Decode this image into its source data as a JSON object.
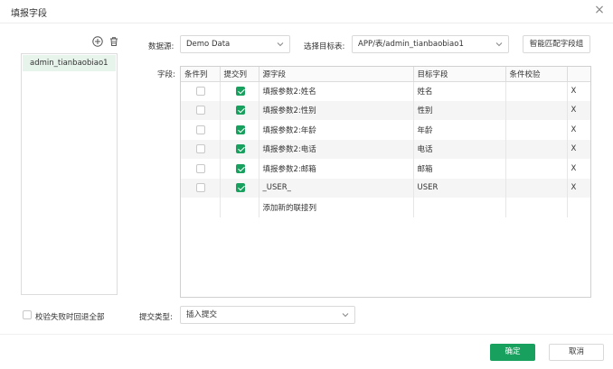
{
  "dialog": {
    "title": "填报字段"
  },
  "datasource_panel": {
    "items": [
      {
        "label": "admin_tianbaobiao1"
      }
    ]
  },
  "form": {
    "datasource_label": "数据源:",
    "datasource_value": "Demo Data",
    "target_table_label": "选择目标表:",
    "target_table_value": "APP/表/admin_tianbaobiao1",
    "smart_match_label": "智能匹配字段组",
    "fields_label": "字段:"
  },
  "grid": {
    "headers": [
      "条件列",
      "提交列",
      "源字段",
      "目标字段",
      "条件校验",
      ""
    ],
    "rows": [
      {
        "condition": false,
        "submit": true,
        "source": "填报参数2:姓名",
        "target": "姓名",
        "check": "",
        "delete": "X"
      },
      {
        "condition": false,
        "submit": true,
        "source": "填报参数2:性别",
        "target": "性别",
        "check": "",
        "delete": "X"
      },
      {
        "condition": false,
        "submit": true,
        "source": "填报参数2:年龄",
        "target": "年龄",
        "check": "",
        "delete": "X"
      },
      {
        "condition": false,
        "submit": true,
        "source": "填报参数2:电话",
        "target": "电话",
        "check": "",
        "delete": "X"
      },
      {
        "condition": false,
        "submit": true,
        "source": "填报参数2:邮箱",
        "target": "邮箱",
        "check": "",
        "delete": "X"
      },
      {
        "condition": false,
        "submit": true,
        "source": "_USER_",
        "target": "USER",
        "check": "",
        "delete": "X"
      }
    ],
    "add_row_label": "添加新的联接列"
  },
  "bottom": {
    "rollback_label": "校验失败时回退全部",
    "rollback_checked": false,
    "submit_type_label": "提交类型:",
    "submit_type_value": "插入提交"
  },
  "footer": {
    "ok_label": "确定",
    "cancel_label": "取消"
  },
  "colors": {
    "accent": "#18a05e",
    "selected_bg": "#e7f4ec"
  }
}
